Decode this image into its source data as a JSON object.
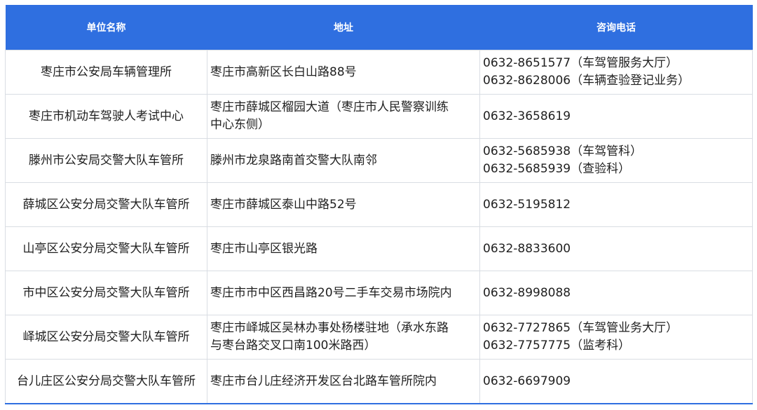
{
  "table": {
    "headers": [
      "单位名称",
      "地址",
      "咨询电话"
    ],
    "rows": [
      {
        "name": "枣庄市公安局车辆管理所",
        "address": [
          "枣庄市高新区长白山路88号"
        ],
        "phones": [
          "0632-8651577（车驾管服务大厅）",
          "0632-8628006（车辆查验登记业务）"
        ]
      },
      {
        "name": "枣庄市机动车驾驶人考试中心",
        "address": [
          "枣庄市薛城区榴园大道（枣庄市人民警察训练",
          "中心东侧）"
        ],
        "phones": [
          "0632-3658619"
        ]
      },
      {
        "name": "滕州市公安局交警大队车管所",
        "address": [
          "滕州市龙泉路南首交警大队南邻"
        ],
        "phones": [
          "0632-5685938（车驾管科）",
          "0632-5685939（查验科）"
        ]
      },
      {
        "name": "薛城区公安分局交警大队车管所",
        "address": [
          "枣庄市薛城区泰山中路52号"
        ],
        "phones": [
          "0632-5195812"
        ]
      },
      {
        "name": "山亭区公安分局交警大队车管所",
        "address": [
          "枣庄市山亭区银光路"
        ],
        "phones": [
          "0632-8833600"
        ]
      },
      {
        "name": "市中区公安分局交警大队车管所",
        "address": [
          "枣庄市市中区西昌路20号二手车交易市场院内"
        ],
        "phones": [
          "0632-8998088"
        ]
      },
      {
        "name": "峄城区公安分局交警大队车管所",
        "address": [
          "枣庄市峄城区吴林办事处杨楼驻地（承水东路",
          "与枣台路交叉口南100米路西）"
        ],
        "phones": [
          "0632-7727865（车驾管业务大厅）",
          "0632-7757775（监考科）"
        ]
      },
      {
        "name": "台儿庄区公安分局交警大队车管所",
        "address": [
          "枣庄市台儿庄经济开发区台北路车管所院内"
        ],
        "phones": [
          "0632-6697909"
        ]
      }
    ]
  },
  "colors": {
    "header_bg": "#2f6fe0",
    "header_text": "#ffffff",
    "border": "#d9dde3"
  }
}
